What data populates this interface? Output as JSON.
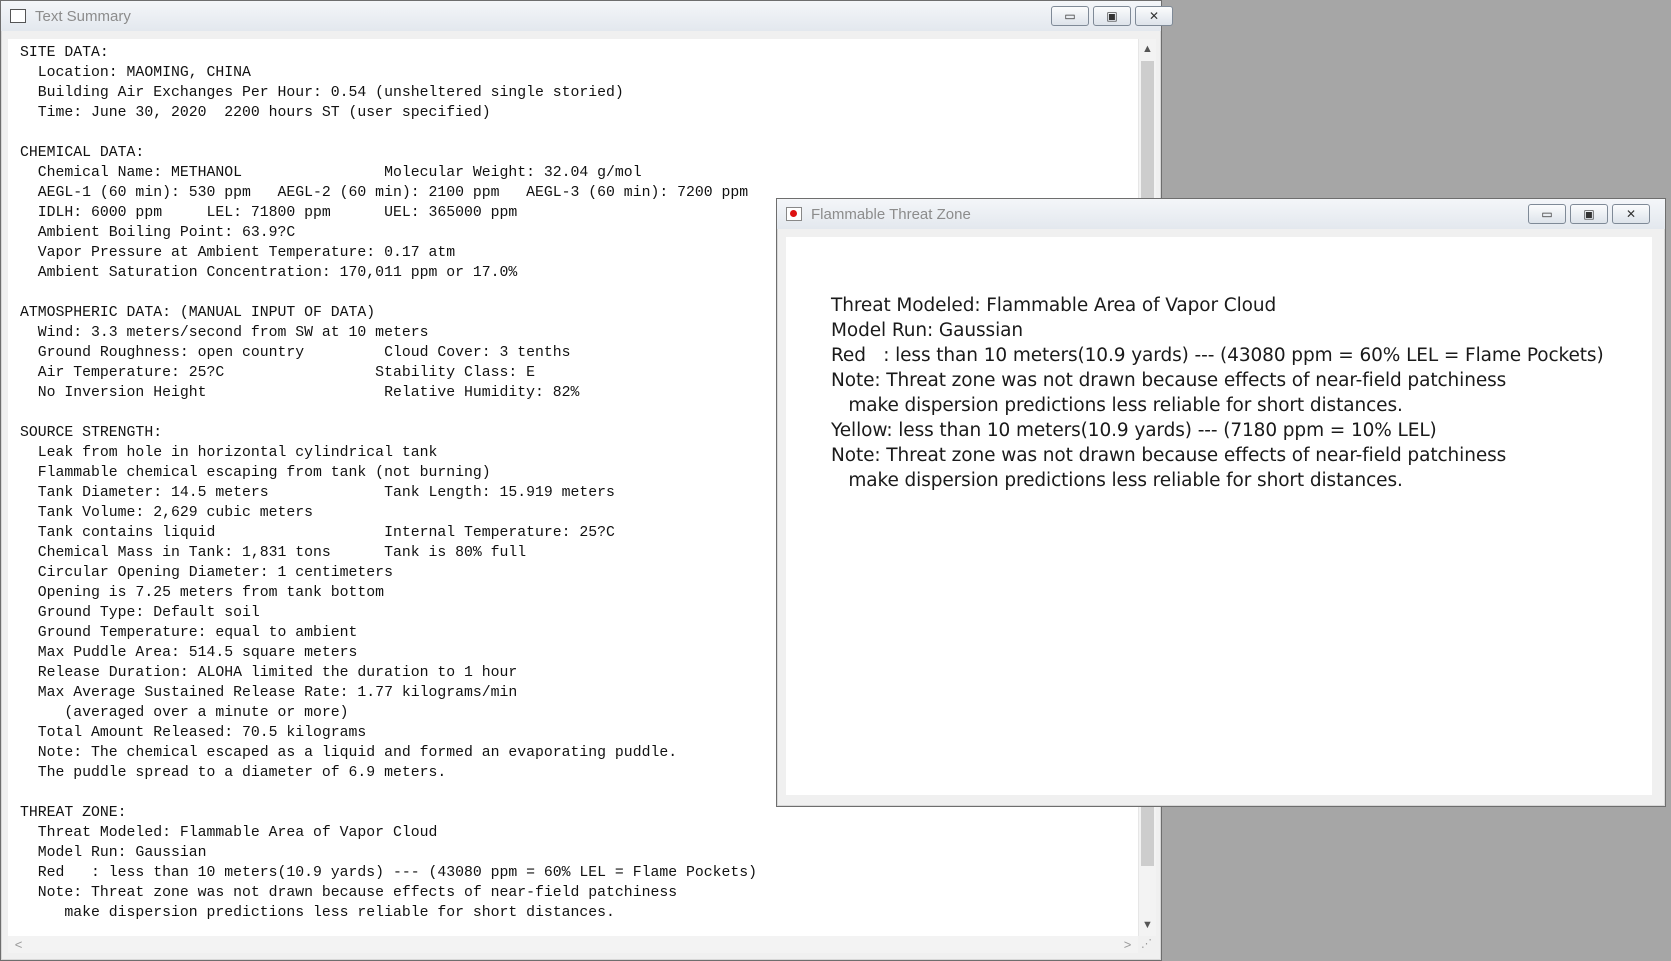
{
  "summary_window": {
    "title": "Text Summary",
    "controls": {
      "minimize": "▭",
      "maximize": "▣",
      "close": "✕"
    },
    "text": "SITE DATA:\n  Location: MAOMING, CHINA\n  Building Air Exchanges Per Hour: 0.54 (unsheltered single storied)\n  Time: June 30, 2020  2200 hours ST (user specified)\n\nCHEMICAL DATA:\n  Chemical Name: METHANOL                Molecular Weight: 32.04 g/mol\n  AEGL-1 (60 min): 530 ppm   AEGL-2 (60 min): 2100 ppm   AEGL-3 (60 min): 7200 ppm\n  IDLH: 6000 ppm     LEL: 71800 ppm      UEL: 365000 ppm\n  Ambient Boiling Point: 63.9?C\n  Vapor Pressure at Ambient Temperature: 0.17 atm\n  Ambient Saturation Concentration: 170,011 ppm or 17.0%\n\nATMOSPHERIC DATA: (MANUAL INPUT OF DATA)\n  Wind: 3.3 meters/second from SW at 10 meters\n  Ground Roughness: open country         Cloud Cover: 3 tenths\n  Air Temperature: 25?C                 Stability Class: E\n  No Inversion Height                    Relative Humidity: 82%\n\nSOURCE STRENGTH:\n  Leak from hole in horizontal cylindrical tank\n  Flammable chemical escaping from tank (not burning)\n  Tank Diameter: 14.5 meters             Tank Length: 15.919 meters\n  Tank Volume: 2,629 cubic meters\n  Tank contains liquid                   Internal Temperature: 25?C\n  Chemical Mass in Tank: 1,831 tons      Tank is 80% full\n  Circular Opening Diameter: 1 centimeters\n  Opening is 7.25 meters from tank bottom\n  Ground Type: Default soil\n  Ground Temperature: equal to ambient\n  Max Puddle Area: 514.5 square meters\n  Release Duration: ALOHA limited the duration to 1 hour\n  Max Average Sustained Release Rate: 1.77 kilograms/min\n     (averaged over a minute or more)\n  Total Amount Released: 70.5 kilograms\n  Note: The chemical escaped as a liquid and formed an evaporating puddle.\n  The puddle spread to a diameter of 6.9 meters.\n\nTHREAT ZONE:\n  Threat Modeled: Flammable Area of Vapor Cloud\n  Model Run: Gaussian\n  Red   : less than 10 meters(10.9 yards) --- (43080 ppm = 60% LEL = Flame Pockets)\n  Note: Threat zone was not drawn because effects of near-field patchiness\n     make dispersion predictions less reliable for short distances.",
    "scroll": {
      "up": "▲",
      "down": "▼",
      "left": "<",
      "right": ">",
      "grip": "⋰"
    }
  },
  "threat_window": {
    "title": "Flammable Threat Zone",
    "controls": {
      "minimize": "▭",
      "maximize": "▣",
      "close": "✕"
    },
    "text": "Threat Modeled: Flammable Area of Vapor Cloud\nModel Run: Gaussian\nRed   : less than 10 meters(10.9 yards) --- (43080 ppm = 60% LEL = Flame Pockets)\nNote: Threat zone was not drawn because effects of near-field patchiness\n   make dispersion predictions less reliable for short distances.\nYellow: less than 10 meters(10.9 yards) --- (7180 ppm = 10% LEL)\nNote: Threat zone was not drawn because effects of near-field patchiness\n   make dispersion predictions less reliable for short distances."
  }
}
